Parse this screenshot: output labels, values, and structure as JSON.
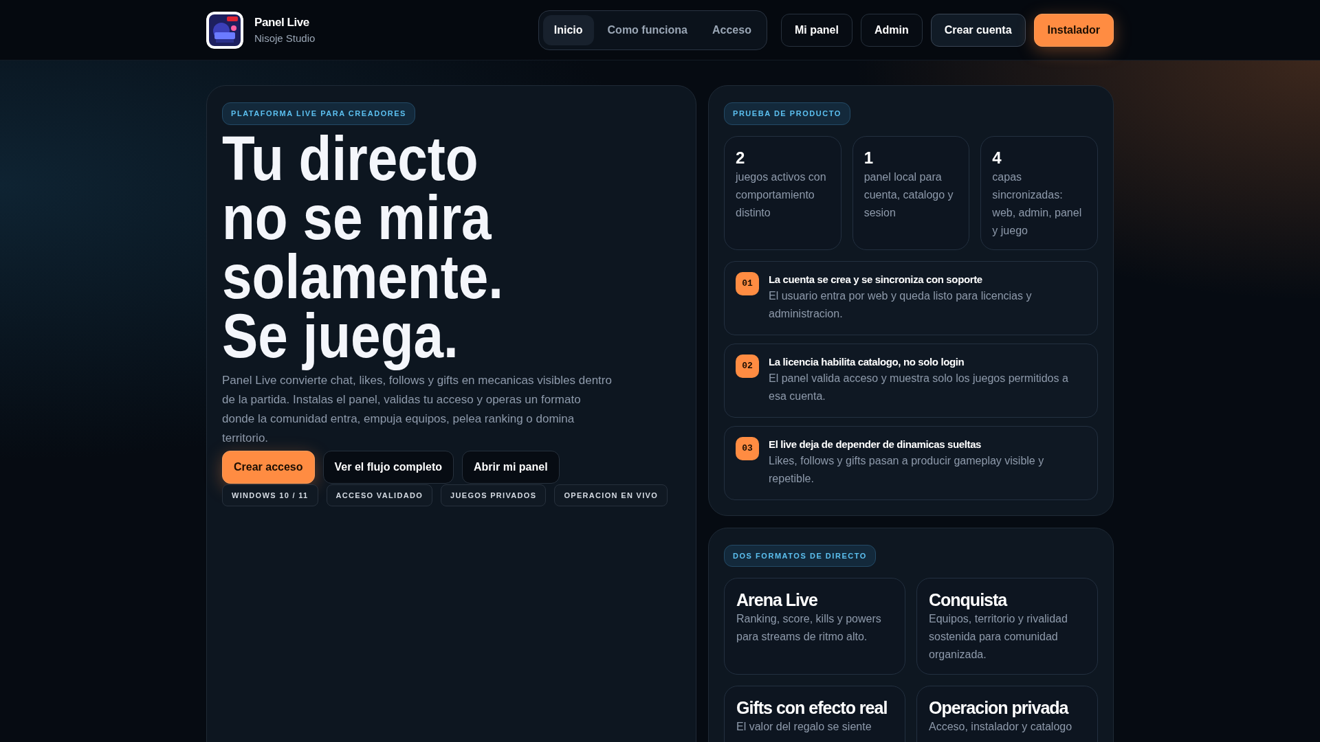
{
  "header": {
    "brand": {
      "name": "Panel Live",
      "subtitle": "Nisoje Studio"
    },
    "nav": [
      {
        "label": "Inicio",
        "selected": true
      },
      {
        "label": "Como funciona",
        "selected": false
      },
      {
        "label": "Acceso",
        "selected": false
      }
    ],
    "actions": [
      {
        "label": "Mi panel",
        "kind": "outline"
      },
      {
        "label": "Admin",
        "kind": "outline"
      },
      {
        "label": "Crear cuenta",
        "kind": "secondary"
      },
      {
        "label": "Instalador",
        "kind": "primary"
      }
    ]
  },
  "hero": {
    "badge": "PLATAFORMA LIVE PARA CREADORES",
    "headline": [
      "Tu directo",
      "no se mira",
      "solamente.",
      "Se juega."
    ],
    "paragraph": "Panel Live convierte chat, likes, follows y gifts en mecanicas visibles dentro de la partida. Instalas el panel, validas tu acceso y operas un formato donde la comunidad entra, empuja equipos, pelea ranking o domina territorio.",
    "buttons": [
      {
        "label": "Crear acceso",
        "kind": "primary"
      },
      {
        "label": "Ver el flujo completo",
        "kind": "outline"
      },
      {
        "label": "Abrir mi panel",
        "kind": "outline"
      }
    ],
    "tags": [
      "WINDOWS 10 / 11",
      "ACCESO VALIDADO",
      "JUEGOS PRIVADOS",
      "OPERACION EN VIVO"
    ]
  },
  "product": {
    "badge": "PRUEBA DE PRODUCTO",
    "stats": [
      {
        "value": "2",
        "text": "juegos activos con comportamiento distinto"
      },
      {
        "value": "1",
        "text": "panel local para cuenta, catalogo y sesion"
      },
      {
        "value": "4",
        "text": "capas sincronizadas: web, admin, panel y juego"
      }
    ],
    "steps": [
      {
        "number": "01",
        "title": "La cuenta se crea y se sincroniza con soporte",
        "text": "El usuario entra por web y queda listo para licencias y administracion."
      },
      {
        "number": "02",
        "title": "La licencia habilita catalogo, no solo login",
        "text": "El panel valida acceso y muestra solo los juegos permitidos a esa cuenta."
      },
      {
        "number": "03",
        "title": "El live deja de depender de dinamicas sueltas",
        "text": "Likes, follows y gifts pasan a producir gameplay visible y repetible."
      }
    ]
  },
  "formats": {
    "badge": "DOS FORMATOS DE DIRECTO",
    "cards": [
      {
        "title": "Arena Live",
        "text": "Ranking, score, kills y powers para streams de ritmo alto."
      },
      {
        "title": "Conquista",
        "text": "Equipos, territorio y rivalidad sostenida para comunidad organizada."
      },
      {
        "title": "Gifts con efecto real",
        "text": "El valor del regalo se siente"
      },
      {
        "title": "Operacion privada",
        "text": "Acceso, instalador y catalogo"
      }
    ]
  }
}
